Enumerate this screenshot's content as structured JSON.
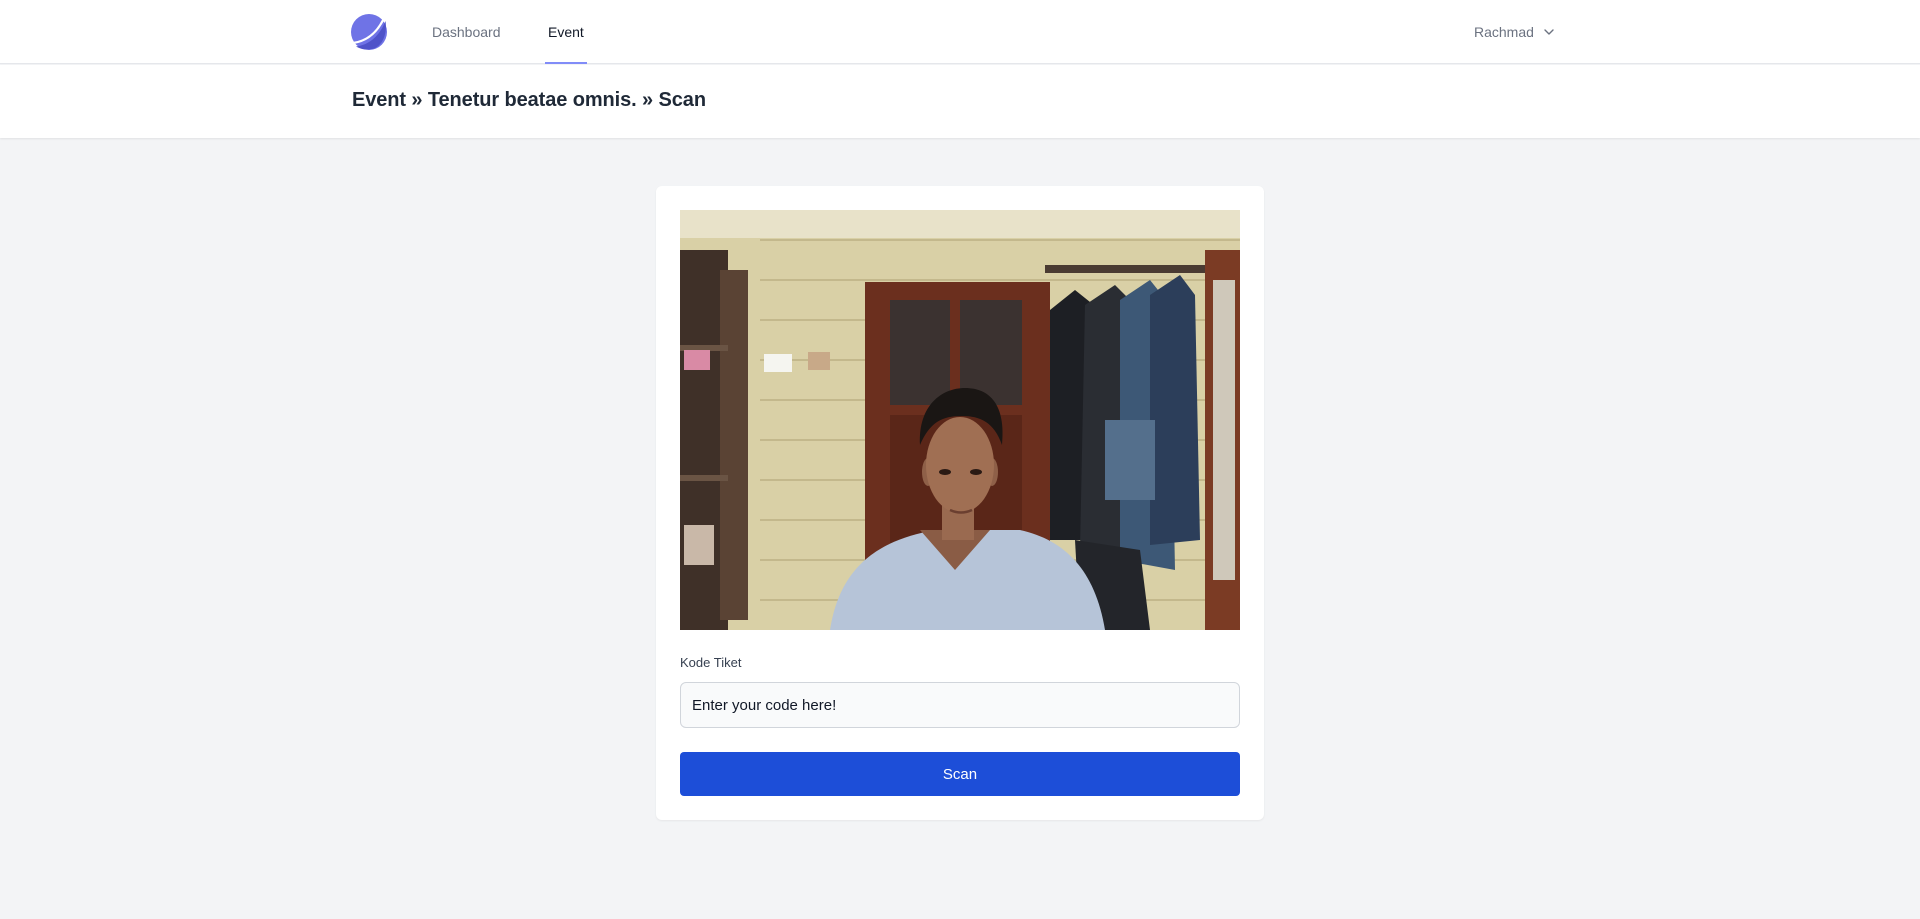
{
  "app": {
    "logo_icon": "crescent-logo-icon",
    "accent": "#818cf8",
    "primary_button": "#1d4ed8"
  },
  "nav": {
    "items": [
      {
        "label": "Dashboard",
        "active": false
      },
      {
        "label": "Event",
        "active": true
      }
    ],
    "user": {
      "name": "Rachmad",
      "icon": "chevron-down-icon"
    }
  },
  "header": {
    "breadcrumb": "Event » Tenetur beatae omnis. » Scan"
  },
  "scanner": {
    "camera_icon": "webcam-preview",
    "field_label": "Kode Tiket",
    "input_value": "",
    "input_placeholder": "Enter your code here!",
    "button_label": "Scan"
  }
}
